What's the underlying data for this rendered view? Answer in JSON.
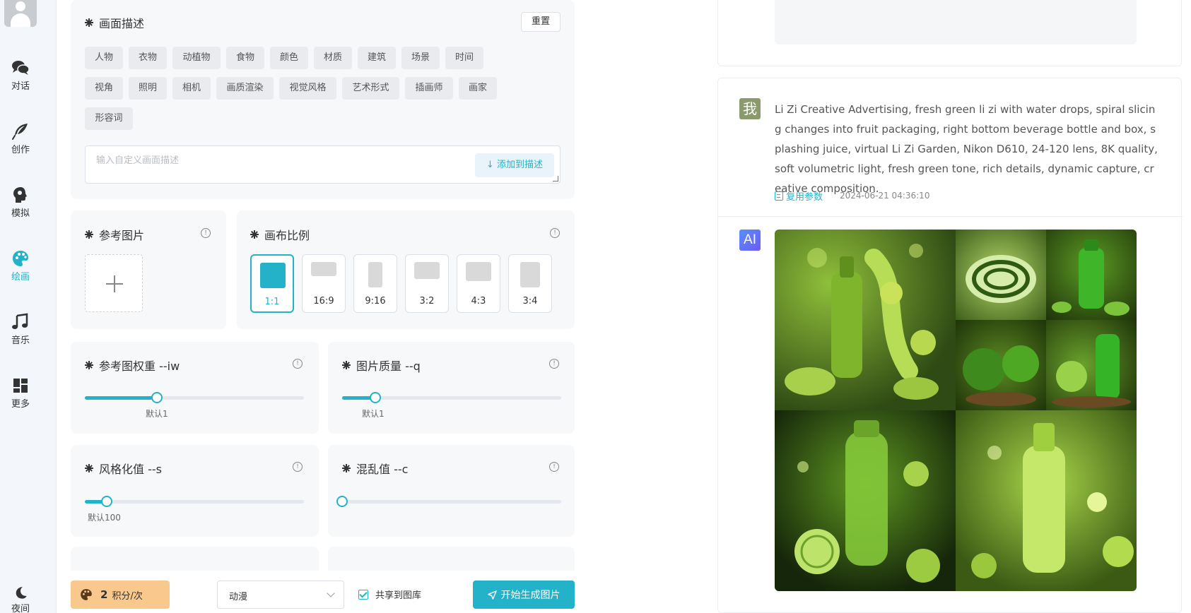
{
  "sidebar": {
    "items": [
      {
        "label": "对话",
        "icon": "chat-icon",
        "active": false
      },
      {
        "label": "创作",
        "icon": "feather-icon",
        "active": false
      },
      {
        "label": "模拟",
        "icon": "head-profile-icon",
        "active": false
      },
      {
        "label": "绘画",
        "icon": "palette-icon",
        "active": true
      },
      {
        "label": "音乐",
        "icon": "music-note-icon",
        "active": false
      },
      {
        "label": "更多",
        "icon": "grid-icon",
        "active": false
      },
      {
        "label": "夜间",
        "icon": "moon-icon",
        "active": false
      }
    ]
  },
  "description": {
    "title": "画面描述",
    "reset_label": "重置",
    "tags": [
      "人物",
      "衣物",
      "动植物",
      "食物",
      "颜色",
      "材质",
      "建筑",
      "场景",
      "时间",
      "视角",
      "照明",
      "相机",
      "画质渲染",
      "视觉风格",
      "艺术形式",
      "插画师",
      "画家",
      "形容词"
    ],
    "input_placeholder": "输入自定义画面描述",
    "add_label": "添加到描述"
  },
  "reference": {
    "title": "参考图片"
  },
  "ratio": {
    "title": "画布比例",
    "options": [
      "1:1",
      "16:9",
      "9:16",
      "3:2",
      "4:3",
      "3:4"
    ],
    "selected": "1:1"
  },
  "sliders": {
    "iw": {
      "title": "参考图权重 --iw",
      "hint": "默认1",
      "fraction": 0.33
    },
    "q": {
      "title": "图片质量 --q",
      "hint": "默认1",
      "fraction": 0.15
    },
    "s": {
      "title": "风格化值 --s",
      "hint": "默认100",
      "fraction": 0.1
    },
    "c": {
      "title": "混乱值 --c",
      "fraction": 0.0
    }
  },
  "bottom": {
    "points_value": "2",
    "points_unit": "积分/次",
    "style_value": "动漫",
    "share_label": "共享到图库",
    "share_checked": true,
    "generate_label": "开始生成图片"
  },
  "chat": {
    "user_badge": "我",
    "ai_badge": "AI",
    "prompt": "Li Zi Creative Advertising, fresh green li zi with water drops, spiral slicing changes into fruit packaging, right bottom beverage bottle and box, splashing juice, virtual Li Zi Garden, Nikon D610, 24-120 lens, 8K quality, soft volumetric light, fresh green tone, rich details, dynamic capture, creative composition.",
    "reuse_label": "复用参数",
    "timestamp": "2024-06-21 04:36:10"
  },
  "colors": {
    "accent": "#24b2c8",
    "points_bg": "#f8c88c",
    "green_dark": "#2f4a14",
    "green_light": "#a8d64a"
  }
}
